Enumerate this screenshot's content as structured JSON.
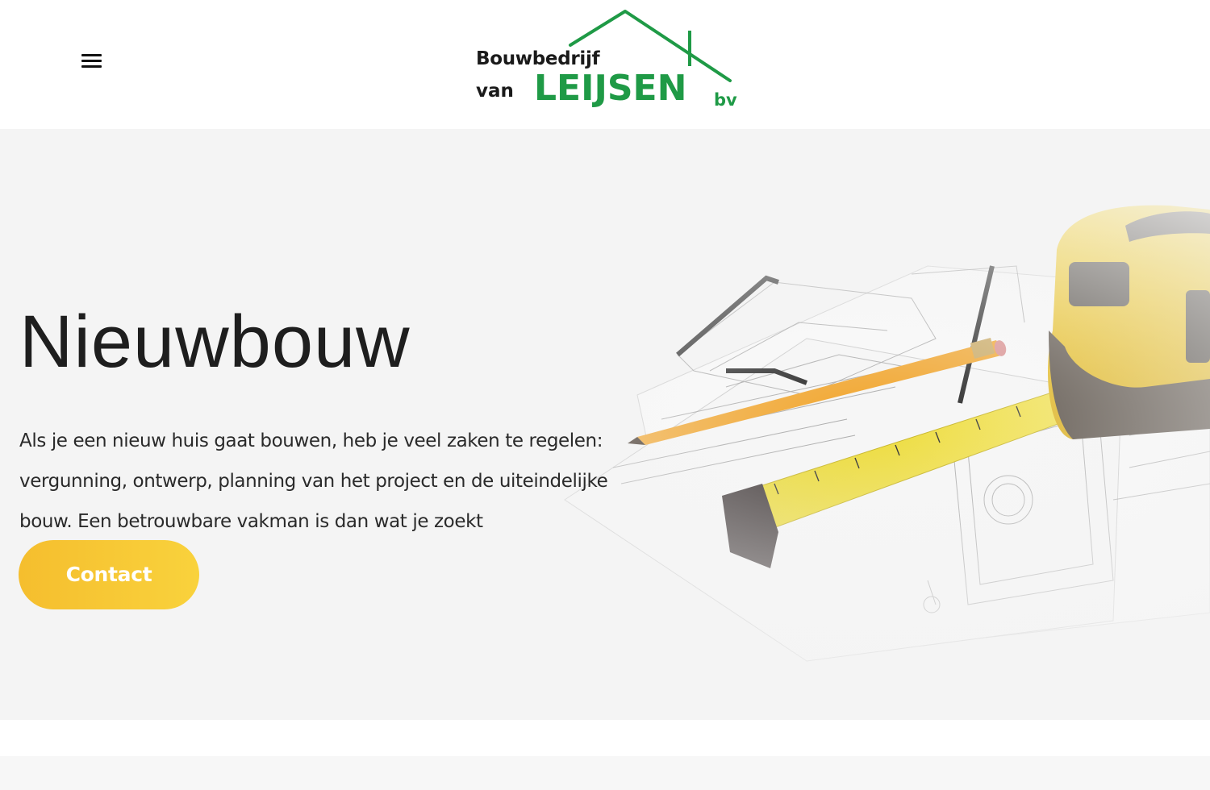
{
  "header": {
    "menu_icon": "hamburger-menu-icon",
    "logo": {
      "line1": "Bouwbedrijf",
      "line2": "van",
      "main": "LEIJSEN",
      "suffix": "bv",
      "brand_color": "#1f9a46"
    }
  },
  "hero": {
    "title": "Nieuwbouw",
    "text": "Als je een nieuw huis gaat bouwen, heb je veel zaken te regelen: vergunning, ontwerp, planning van het project en de uiteindelijke bouw. Een betrouwbare vakman is dan wat je zoekt",
    "cta_label": "Contact",
    "cta_color": "#f7c531",
    "background_color": "#f4f4f4",
    "image": "blueprint-tape-measure-pencil-image"
  }
}
